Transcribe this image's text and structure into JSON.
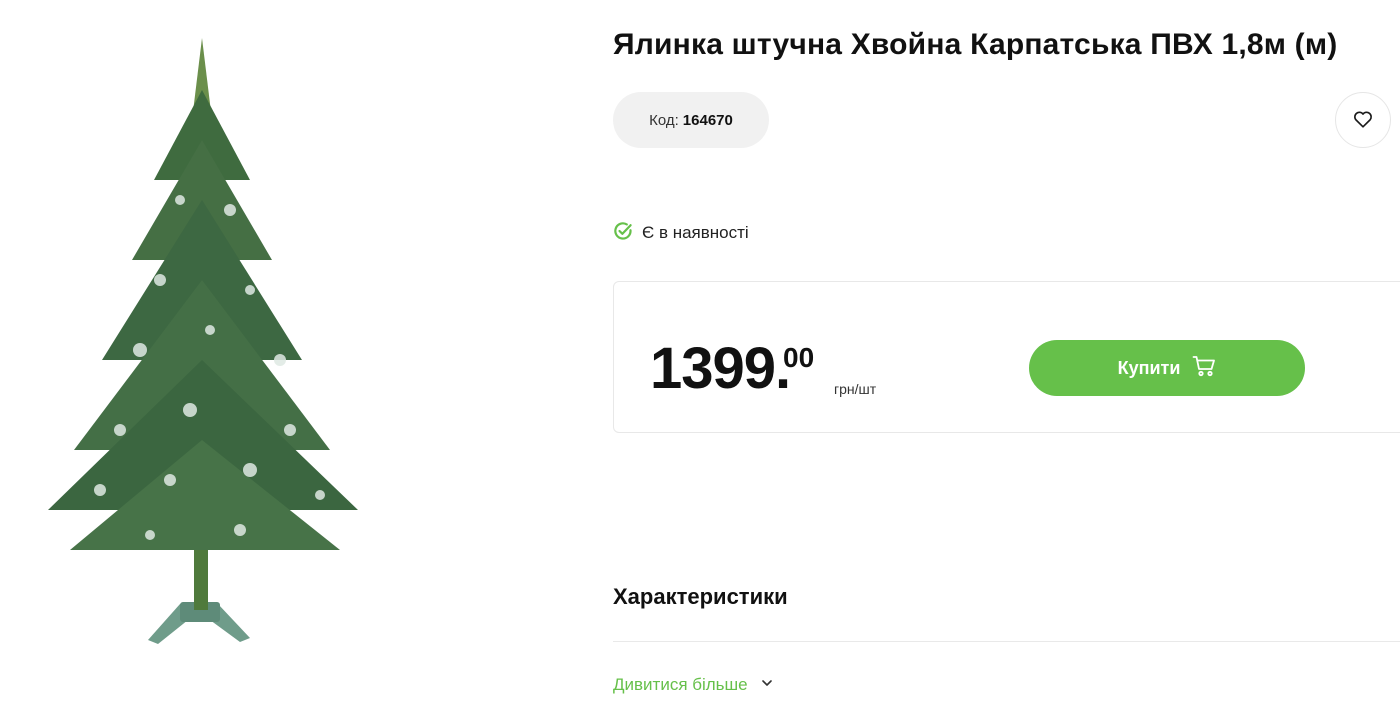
{
  "product": {
    "title": "Ялинка штучна Хвойна Карпатська ПВХ 1,8м (м)",
    "code_label": "Код:",
    "code_value": "164670",
    "image_icon": "christmas-tree-image"
  },
  "favorite": {
    "icon": "heart-icon"
  },
  "availability": {
    "icon": "check-circle-icon",
    "text": "Є в наявності",
    "color": "#66c04a"
  },
  "price": {
    "main": "1399",
    "dot": ".",
    "cents": "00",
    "unit": "грн/шт"
  },
  "buy_button": {
    "label": "Купити",
    "icon": "cart-icon",
    "color": "#66c04a"
  },
  "characteristics": {
    "title": "Характеристики",
    "see_more_label": "Дивитися більше",
    "see_more_icon": "chevron-down-icon"
  }
}
